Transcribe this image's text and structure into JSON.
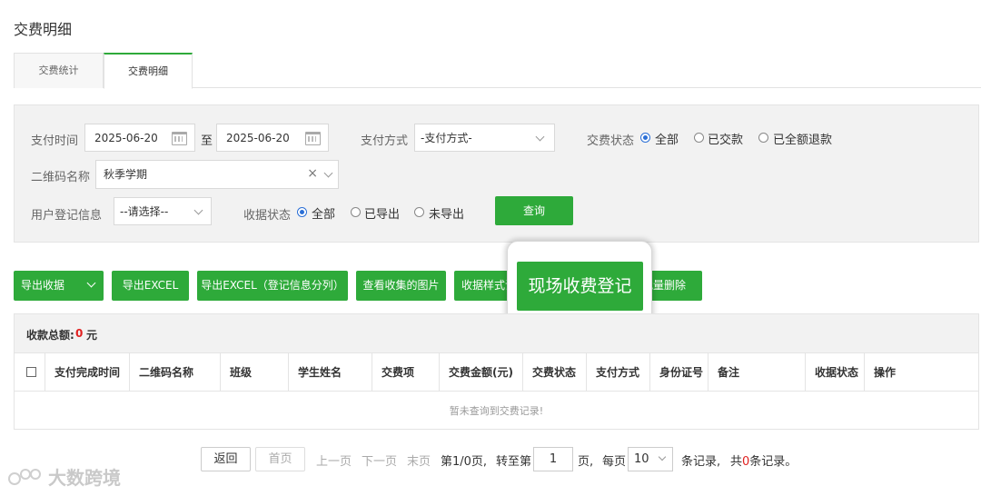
{
  "page": {
    "title": "交费明细"
  },
  "tabs": [
    {
      "label": "交费统计"
    },
    {
      "label": "交费明细"
    }
  ],
  "filters": {
    "pay_time_label": "支付时间",
    "date_from": "2025-06-20",
    "date_sep": "至",
    "date_to": "2025-06-20",
    "pay_method_label": "支付方式",
    "pay_method_value": "-支付方式-",
    "status_label": "交费状态",
    "status_options": [
      "全部",
      "已交款",
      "已全额退款"
    ],
    "status_selected": "全部",
    "qr_label": "二维码名称",
    "qr_value": "秋季学期",
    "reg_info_label": "用户登记信息",
    "reg_info_value": "--请选择--",
    "receipt_label": "收据状态",
    "receipt_options": [
      "全部",
      "已导出",
      "未导出"
    ],
    "receipt_selected": "全部",
    "query_button": "查询"
  },
  "actions": {
    "export_receipt": "导出收据",
    "export_excel": "导出EXCEL",
    "export_excel_split": "导出EXCEL（登记信息分列）",
    "view_images": "查看收集的图片",
    "receipt_style": "收据样式设",
    "onsite_register": "现场收费登记",
    "bulk_delete": "批量删除"
  },
  "summary": {
    "label": "收款总额:",
    "amount": "0",
    "unit": "元"
  },
  "table": {
    "columns": [
      "支付完成时间",
      "二维码名称",
      "班级",
      "学生姓名",
      "交费项",
      "交费金额(元)",
      "交费状态",
      "支付方式",
      "身份证号",
      "备注",
      "收据状态",
      "操作"
    ],
    "empty_text": "暂未查询到交费记录!"
  },
  "pager": {
    "back": "返回",
    "first": "首页",
    "prev": "上一页",
    "next": "下一页",
    "last": "末页",
    "page_info": "第1/0页,",
    "goto_prefix": "转至第",
    "goto_value": "1",
    "goto_suffix": "页,",
    "per_page_prefix": "每页",
    "per_page_value": "10",
    "per_page_suffix": "条记录,",
    "total_prefix": "共",
    "total_count": "0",
    "total_suffix": "条记录。"
  },
  "watermark": {
    "text": "大数跨境"
  },
  "colors": {
    "accent_green": "#2eaa3a",
    "radio_blue": "#2b6fd6",
    "total_red": "#e02020"
  }
}
